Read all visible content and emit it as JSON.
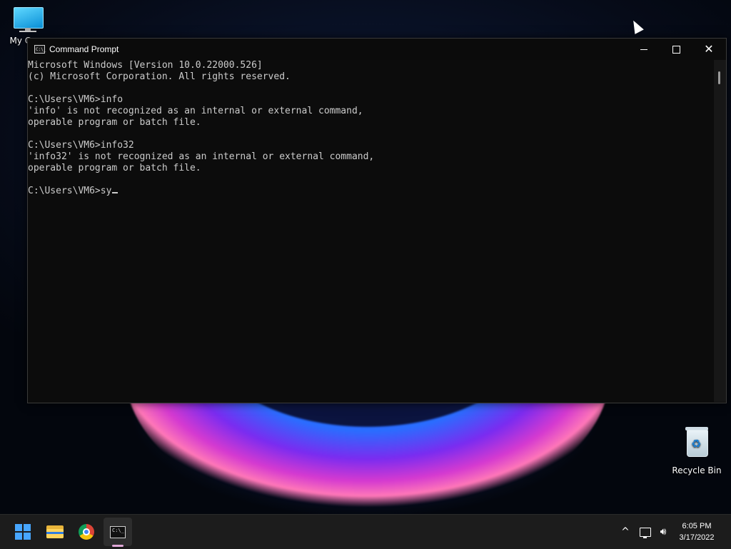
{
  "desktop": {
    "icons": [
      {
        "label": "My Computer",
        "icon": "monitor-icon"
      },
      {
        "label": "Recycle Bin",
        "icon": "recycle-bin-icon"
      }
    ],
    "my_computer_visible_label": "My Co"
  },
  "window": {
    "title": "Command Prompt",
    "icon": "cmd-icon",
    "controls": {
      "minimize": "minimize-icon",
      "maximize": "maximize-icon",
      "close": "close-icon"
    }
  },
  "console": {
    "lines": [
      "Microsoft Windows [Version 10.0.22000.526]",
      "(c) Microsoft Corporation. All rights reserved.",
      "",
      "C:\\Users\\VM6>info",
      "'info' is not recognized as an internal or external command,",
      "operable program or batch file.",
      "",
      "C:\\Users\\VM6>info32",
      "'info32' is not recognized as an internal or external command,",
      "operable program or batch file.",
      "",
      "C:\\Users\\VM6>sy"
    ],
    "text_color": "#cccccc",
    "background": "#0c0c0c"
  },
  "taskbar": {
    "apps": [
      {
        "name": "start",
        "icon": "windows-start-icon"
      },
      {
        "name": "file-explorer",
        "icon": "folder-icon"
      },
      {
        "name": "chrome",
        "icon": "chrome-icon"
      },
      {
        "name": "command-prompt",
        "icon": "cmd-icon",
        "active": true
      }
    ],
    "tray": {
      "chevron": "^",
      "network_icon": "network-icon",
      "volume_icon": "volume-icon",
      "time": "6:05 PM",
      "date": "3/17/2022"
    }
  }
}
